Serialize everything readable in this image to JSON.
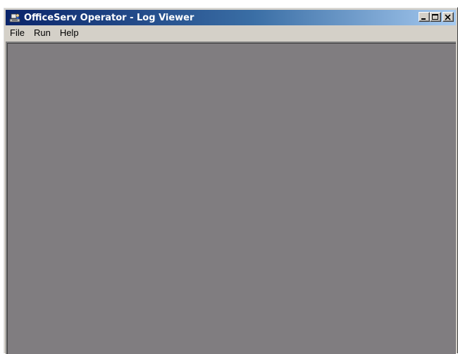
{
  "window": {
    "title": "OfficeServ Operator - Log Viewer",
    "icon": "operator-app-icon",
    "caption_buttons": [
      "minimize-icon",
      "maximize-icon",
      "close-icon"
    ]
  },
  "menu": {
    "items": [
      {
        "label": "File"
      },
      {
        "label": "Run"
      },
      {
        "label": "Help"
      }
    ]
  },
  "colors": {
    "titlebar_start": "#0a246a",
    "titlebar_end": "#a6caf0",
    "client_background": "#807d80",
    "chrome": "#d4d0c8"
  }
}
